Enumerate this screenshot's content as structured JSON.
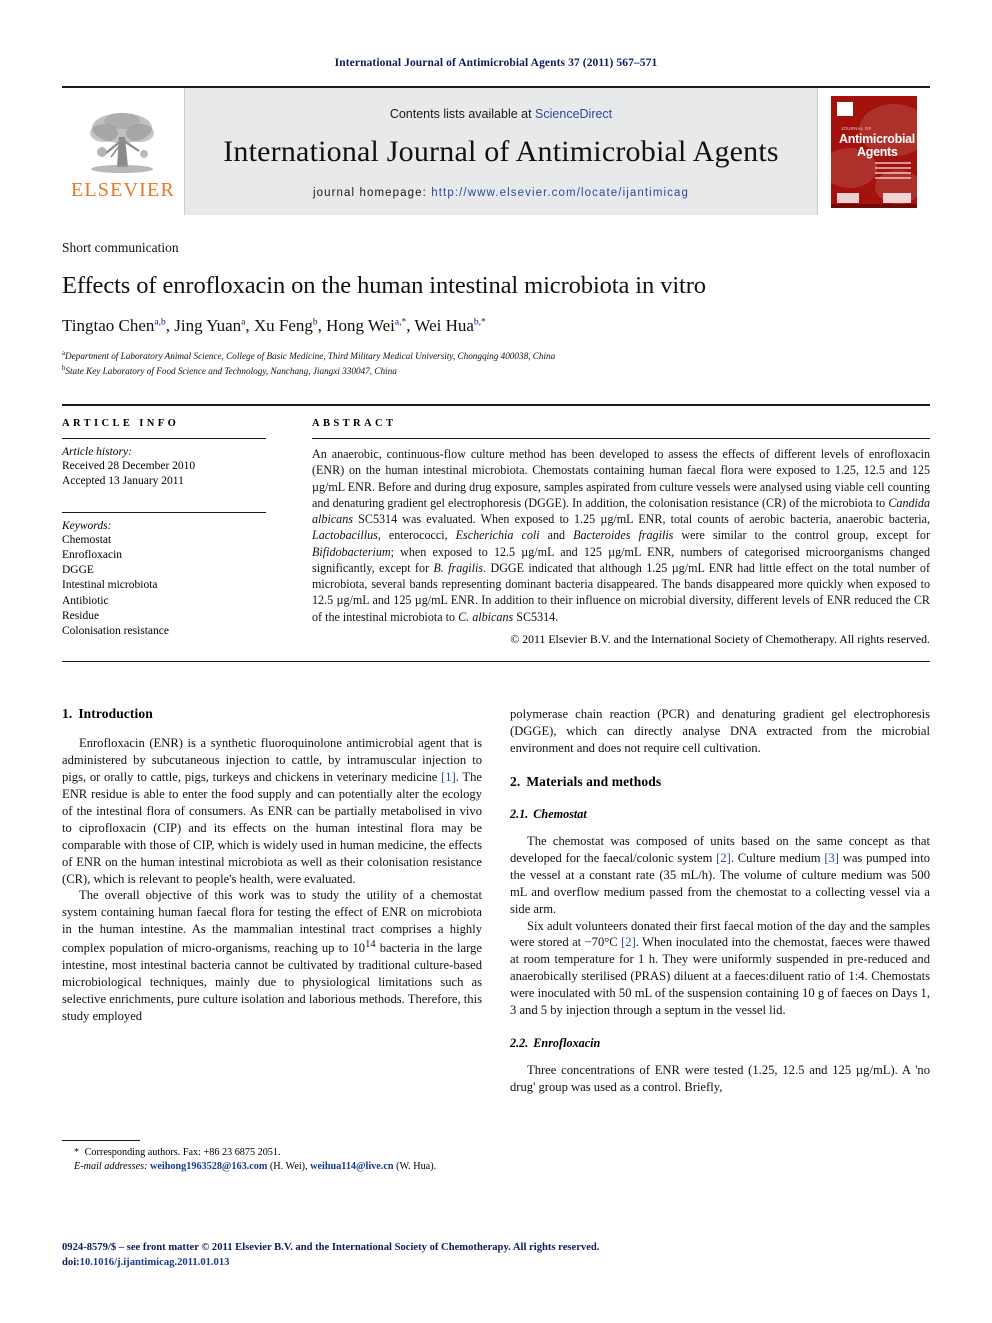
{
  "running_head": "International Journal of Antimicrobial Agents 37 (2011) 567–571",
  "masthead": {
    "publisher_wordmark": "ELSEVIER",
    "contents_prefix": "Contents lists available at ",
    "contents_link": "ScienceDirect",
    "journal_title": "International Journal of Antimicrobial Agents",
    "homepage_label": "journal homepage: ",
    "homepage_url": "http://www.elsevier.com/locate/ijantimicag",
    "cover": {
      "kicker": "JOURNAL OF",
      "line1": "Antimicrobial",
      "line2": "Agents",
      "accent_color": "#a3120c"
    }
  },
  "article": {
    "section_kind": "Short communication",
    "title": "Effects of enrofloxacin on the human intestinal microbiota in vitro",
    "authors_html": "Tingtao Chen<sup>a,b</sup>, Jing Yuan<sup>a</sup>, Xu Feng<sup>b</sup>, Hong Wei<sup>a,*</sup>, Wei Hua<sup>b,*</sup>",
    "affiliations": [
      {
        "marker": "a",
        "text": "Department of Laboratory Animal Science, College of Basic Medicine, Third Military Medical University, Chongqing 400038, China"
      },
      {
        "marker": "b",
        "text": "State Key Laboratory of Food Science and Technology, Nanchang, Jiangxi 330047, China"
      }
    ]
  },
  "article_info": {
    "heading": "ARTICLE INFO",
    "history_label": "Article history:",
    "history": [
      "Received 28 December 2010",
      "Accepted 13 January 2011"
    ],
    "keywords_label": "Keywords:",
    "keywords": [
      "Chemostat",
      "Enrofloxacin",
      "DGGE",
      "Intestinal microbiota",
      "Antibiotic",
      "Residue",
      "Colonisation resistance"
    ]
  },
  "abstract": {
    "heading": "ABSTRACT",
    "body_html": "An anaerobic, continuous-flow culture method has been developed to assess the effects of different levels of enrofloxacin (ENR) on the human intestinal microbiota. Chemostats containing human faecal flora were exposed to 1.25, 12.5 and 125 &micro;g/mL ENR. Before and during drug exposure, samples aspirated from culture vessels were analysed using viable cell counting and denaturing gradient gel electrophoresis (DGGE). In addition, the colonisation resistance (CR) of the microbiota to <i>Candida albicans</i> SC5314 was evaluated. When exposed to 1.25 &micro;g/mL ENR, total counts of aerobic bacteria, anaerobic bacteria, <i>Lactobacillus</i>, enterococci, <i>Escherichia coli</i> and <i>Bacteroides fragilis</i> were similar to the control group, except for <i>Bifidobacterium</i>; when exposed to 12.5 &micro;g/mL and 125 &micro;g/mL ENR, numbers of categorised microorganisms changed significantly, except for <i>B. fragilis</i>. DGGE indicated that although 1.25 &micro;g/mL ENR had little effect on the total number of microbiota, several bands representing dominant bacteria disappeared. The bands disappeared more quickly when exposed to 12.5 &micro;g/mL and 125 &micro;g/mL ENR. In addition to their influence on microbial diversity, different levels of ENR reduced the CR of the intestinal microbiota to <i>C. albicans</i> SC5314.",
    "copyright": "© 2011 Elsevier B.V. and the International Society of Chemotherapy. All rights reserved."
  },
  "body": {
    "left_column": {
      "heading": {
        "number": "1.",
        "text": "Introduction"
      },
      "paragraphs_html": [
        "Enrofloxacin (ENR) is a synthetic fluoroquinolone antimicrobial agent that is administered by subcutaneous injection to cattle, by intramuscular injection to pigs, or orally to cattle, pigs, turkeys and chickens in veterinary medicine <span class=\"ref\">[1]</span>. The ENR residue is able to enter the food supply and can potentially alter the ecology of the intestinal flora of consumers. As ENR can be partially metabolised in vivo to ciprofloxacin (CIP) and its effects on the human intestinal flora may be comparable with those of CIP, which is widely used in human medicine, the effects of ENR on the human intestinal microbiota as well as their colonisation resistance (CR), which is relevant to people's health, were evaluated.",
        "The overall objective of this work was to study the utility of a chemostat system containing human faecal flora for testing the effect of ENR on microbiota in the human intestine. As the mammalian intestinal tract comprises a highly complex population of micro-organisms, reaching up to 10<sup>14</sup> bacteria in the large intestine, most intestinal bacteria cannot be cultivated by traditional culture-based microbiological techniques, mainly due to physiological limitations such as selective enrichments, pure culture isolation and laborious methods. Therefore, this study employed"
      ]
    },
    "right_column": {
      "continuation_html": "polymerase chain reaction (PCR) and denaturing gradient gel electrophoresis (DGGE), which can directly analyse DNA extracted from the microbial environment and does not require cell cultivation.",
      "heading": {
        "number": "2.",
        "text": "Materials and methods"
      },
      "subsections": [
        {
          "number": "2.1.",
          "title": "Chemostat",
          "paragraphs_html": [
            "The chemostat was composed of units based on the same concept as that developed for the faecal/colonic system <span class=\"ref\">[2]</span>. Culture medium <span class=\"ref\">[3]</span> was pumped into the vessel at a constant rate (35 mL/h). The volume of culture medium was 500 mL and overflow medium passed from the chemostat to a collecting vessel via a side arm.",
            "Six adult volunteers donated their first faecal motion of the day and the samples were stored at &minus;70&deg;C <span class=\"ref\">[2]</span>. When inoculated into the chemostat, faeces were thawed at room temperature for 1 h. They were uniformly suspended in pre-reduced and anaerobically sterilised (PRAS) diluent at a faeces:diluent ratio of 1:4. Chemostats were inoculated with 50 mL of the suspension containing 10 g of faeces on Days 1, 3 and 5 by injection through a septum in the vessel lid."
          ]
        },
        {
          "number": "2.2.",
          "title": "Enrofloxacin",
          "paragraphs_html": [
            "Three concentrations of ENR were tested (1.25, 12.5 and 125 &micro;g/mL). A 'no drug' group was used as a control. Briefly,"
          ]
        }
      ]
    }
  },
  "footnotes": {
    "corresponding_html": "<span class=\"star\">*</span> Corresponding authors. Fax: +86 23 6875 2051.",
    "email_label": "E-mail addresses:",
    "emails_html": "<span class=\"mail\">weihong1963528@163.com</span> (H. Wei), <span class=\"mail\">weihua114@live.cn</span> (W. Hua)."
  },
  "imprint": {
    "line1": "0924-8579/$ – see front matter © 2011 Elsevier B.V. and the International Society of Chemotherapy. All rights reserved.",
    "line2_prefix": "doi:",
    "line2_doi": "10.1016/j.ijantimicag.2011.01.013"
  }
}
